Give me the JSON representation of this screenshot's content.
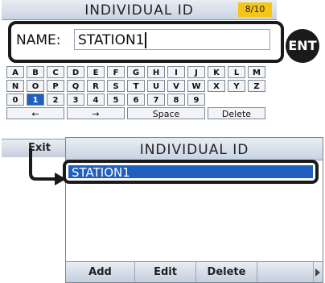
{
  "back_screen": {
    "title": "INDIVIDUAL ID",
    "pager": "8/10",
    "name_label": "NAME:",
    "name_value": "STATION1",
    "keyboard": {
      "row1": [
        "A",
        "B",
        "C",
        "D",
        "E",
        "F",
        "G",
        "H",
        "I",
        "J",
        "K",
        "L",
        "M"
      ],
      "row2": [
        "N",
        "O",
        "P",
        "Q",
        "R",
        "S",
        "T",
        "U",
        "V",
        "W",
        "X",
        "Y",
        "Z"
      ],
      "row3": [
        "0",
        "1",
        "2",
        "3",
        "4",
        "5",
        "6",
        "7",
        "8",
        "9"
      ],
      "selected_key": "1",
      "row4": {
        "left": "←",
        "right": "→",
        "space": "Space",
        "delete": "Delete"
      }
    },
    "exit_label": "Exit"
  },
  "ent_button": {
    "label": "ENT"
  },
  "front_screen": {
    "title": "INDIVIDUAL ID",
    "list": [
      {
        "label": "STATION1"
      }
    ],
    "softkeys": [
      "Add",
      "Edit",
      "Delete"
    ],
    "more_icon": "triangle-right"
  },
  "colors": {
    "highlight": "#1f5fbf",
    "pager_bg": "#f5c518",
    "frame": "#1a1a1a"
  }
}
